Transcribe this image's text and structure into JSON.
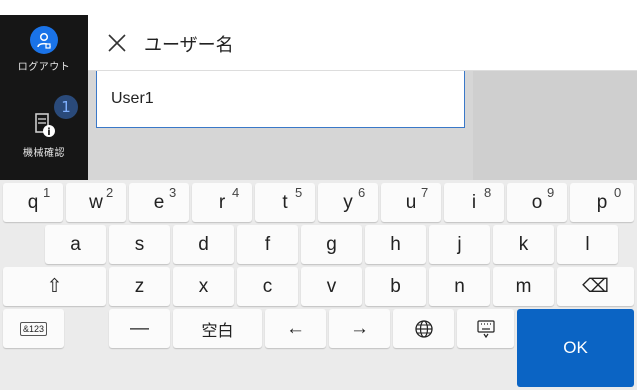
{
  "rail": {
    "logout_label": "ログアウト",
    "check_label": "機械確認",
    "badge_count": "1"
  },
  "header": {
    "title": "ユーザー名"
  },
  "input": {
    "value": "User1"
  },
  "keyboard": {
    "row1": [
      {
        "main": "q",
        "sup": "1"
      },
      {
        "main": "w",
        "sup": "2"
      },
      {
        "main": "e",
        "sup": "3"
      },
      {
        "main": "r",
        "sup": "4"
      },
      {
        "main": "t",
        "sup": "5"
      },
      {
        "main": "y",
        "sup": "6"
      },
      {
        "main": "u",
        "sup": "7"
      },
      {
        "main": "i",
        "sup": "8"
      },
      {
        "main": "o",
        "sup": "9"
      },
      {
        "main": "p",
        "sup": "0"
      }
    ],
    "row2": [
      "a",
      "s",
      "d",
      "f",
      "g",
      "h",
      "j",
      "k",
      "l"
    ],
    "row3": [
      "z",
      "x",
      "c",
      "v",
      "b",
      "n",
      "m"
    ],
    "shift_glyph": "⇧",
    "backspace_glyph": "⌫",
    "mode_label": "&123",
    "dash_label": "—",
    "space_label": "空白",
    "left_arrow": "←",
    "right_arrow": "→",
    "ok_label": "OK"
  },
  "colors": {
    "accent": "#0b64c4",
    "rail_bg": "#161616",
    "keyboard_bg": "#ebebeb"
  }
}
